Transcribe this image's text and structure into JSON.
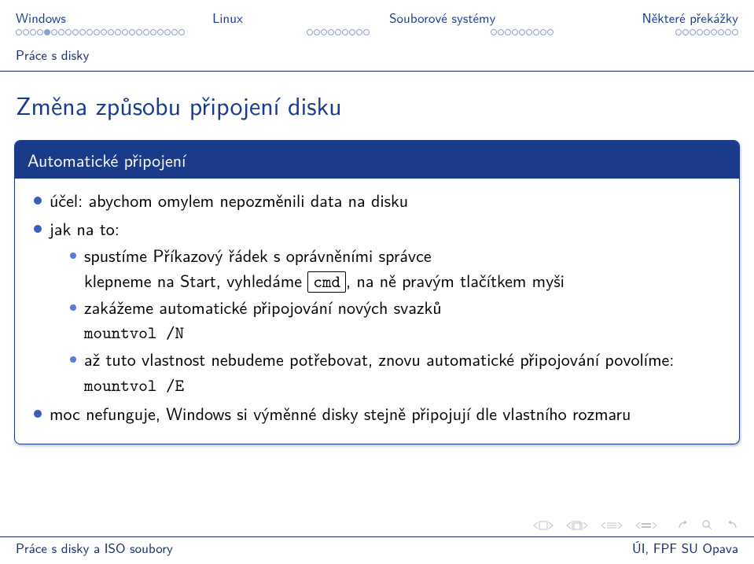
{
  "nav": {
    "items": [
      "Windows",
      "Linux",
      "Souborové systémy",
      "Některé překážky"
    ],
    "dots": [
      {
        "total": 24,
        "filled_index": 4
      },
      {
        "total": 9,
        "filled_index": -1
      },
      {
        "total": 9,
        "filled_index": -1
      },
      {
        "total": 9,
        "filled_index": -1
      }
    ]
  },
  "section_subtitle": "Práce s disky",
  "title": "Změna způsobu připojení disku",
  "block": {
    "header": "Automatické připojení",
    "items": [
      {
        "text": "účel: abychom omylem nepozměnili data na disku"
      },
      {
        "text": "jak na to:",
        "sub": [
          {
            "pre": "spustíme Příkazový řádek s oprávněními správce",
            "line2_a": "klepneme na Start, vyhledáme ",
            "cmd": "cmd",
            "line2_b": ", na ně pravým tlačítkem myši"
          },
          {
            "pre": "zakážeme automatické připojování nových svazků",
            "code": "mountvol /N"
          },
          {
            "pre": "až tuto vlastnost nebudeme potřebovat, znovu automatické připojování povolíme:",
            "code": "mountvol /E"
          }
        ]
      },
      {
        "text": "moc nefunguje, Windows si výměnné disky stejně připojují dle vlastního rozmaru"
      }
    ]
  },
  "footer": {
    "left": "Práce s disky a ISO soubory",
    "right": "ÚI, FPF SU Opava"
  }
}
